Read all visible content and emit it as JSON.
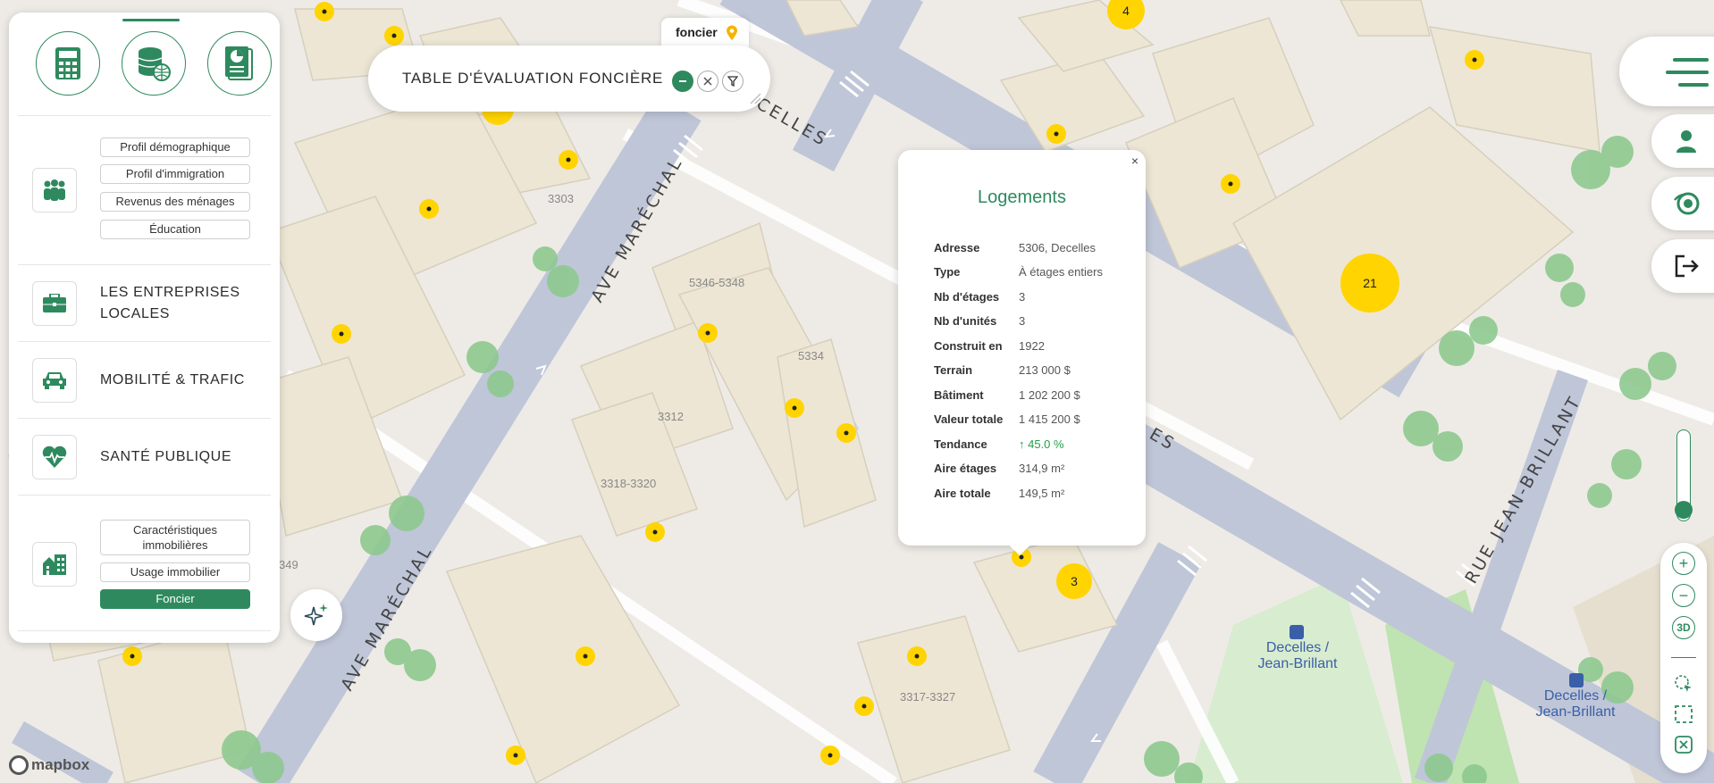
{
  "map": {
    "streets": [
      "AVE MARÉCHAL",
      "AVE MARÉCHAL",
      "CELLES",
      "ES",
      "RUE JEAN-BRILLANT"
    ],
    "building_numbers": [
      "3303",
      "5346-5348",
      "5334",
      "3312",
      "3318-3320",
      "349",
      "3317-3327"
    ],
    "cluster_counts": [
      "4",
      "21",
      "3"
    ],
    "transit_stops": [
      {
        "line1": "Decelles /",
        "line2": "Jean-Brillant"
      },
      {
        "line1": "Decelles /",
        "line2": "Jean-Brillant"
      }
    ],
    "attribution": "mapbox"
  },
  "left_panel": {
    "top_buttons": [
      {
        "icon": "calculator-icon"
      },
      {
        "icon": "database-globe-icon"
      },
      {
        "icon": "report-chart-icon"
      }
    ],
    "sections": [
      {
        "icon": "people-icon",
        "items": [
          "Profil démographique",
          "Profil d'immigration",
          "Revenus des ménages",
          "Éducation"
        ]
      },
      {
        "icon": "briefcase-icon",
        "title_line1": "LES ENTREPRISES",
        "title_line2": "LOCALES"
      },
      {
        "icon": "car-icon",
        "title": "MOBILITÉ & TRAFIC"
      },
      {
        "icon": "heart-pulse-icon",
        "title": "SANTÉ PUBLIQUE"
      },
      {
        "icon": "buildings-icon",
        "items": [
          "Caractéristiques immobilières",
          "Usage immobilier",
          "Foncier"
        ],
        "active": "Foncier"
      }
    ]
  },
  "table_header": {
    "tag": "foncier",
    "title": "TABLE D'ÉVALUATION FONCIÈRE"
  },
  "popup": {
    "close": "×",
    "title": "Logements",
    "rows": [
      {
        "key": "Adresse",
        "value": "5306, Decelles"
      },
      {
        "key": "Type",
        "value": "À étages entiers"
      },
      {
        "key": "Nb d'étages",
        "value": "3"
      },
      {
        "key": "Nb d'unités",
        "value": "3"
      },
      {
        "key": "Construit en",
        "value": "1922"
      },
      {
        "key": "Terrain",
        "value": "213 000 $"
      },
      {
        "key": "Bâtiment",
        "value": "1 202 200 $"
      },
      {
        "key": "Valeur totale",
        "value": "1 415 200 $"
      },
      {
        "key": "Tendance",
        "value": "↑ 45.0 %"
      },
      {
        "key": "Aire étages",
        "value": "314,9 m²"
      },
      {
        "key": "Aire totale",
        "value": "149,5 m²"
      }
    ]
  },
  "right_controls": {
    "zoom_in": "+",
    "zoom_out": "−",
    "view_3d": "3D"
  },
  "colors": {
    "accent": "#2e8a5e",
    "marker": "#ffd400",
    "trend": "#23a047"
  }
}
